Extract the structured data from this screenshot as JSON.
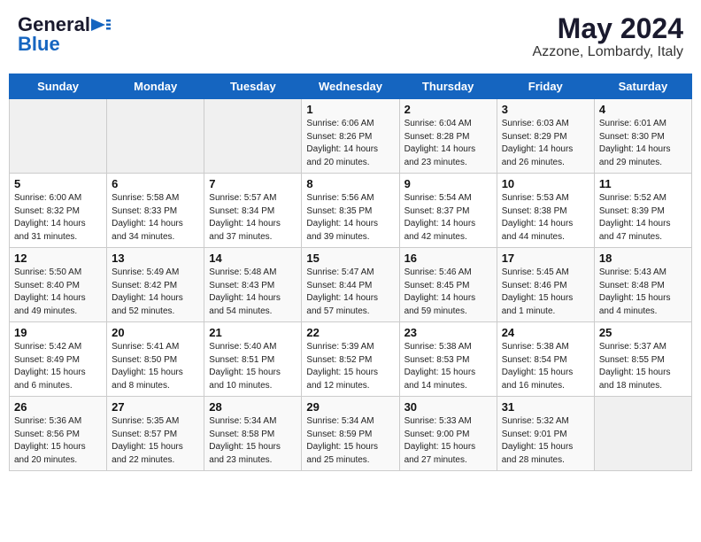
{
  "header": {
    "logo_general": "General",
    "logo_blue": "Blue",
    "month": "May 2024",
    "location": "Azzone, Lombardy, Italy"
  },
  "days_of_week": [
    "Sunday",
    "Monday",
    "Tuesday",
    "Wednesday",
    "Thursday",
    "Friday",
    "Saturday"
  ],
  "weeks": [
    [
      {
        "day": "",
        "info": ""
      },
      {
        "day": "",
        "info": ""
      },
      {
        "day": "",
        "info": ""
      },
      {
        "day": "1",
        "info": "Sunrise: 6:06 AM\nSunset: 8:26 PM\nDaylight: 14 hours\nand 20 minutes."
      },
      {
        "day": "2",
        "info": "Sunrise: 6:04 AM\nSunset: 8:28 PM\nDaylight: 14 hours\nand 23 minutes."
      },
      {
        "day": "3",
        "info": "Sunrise: 6:03 AM\nSunset: 8:29 PM\nDaylight: 14 hours\nand 26 minutes."
      },
      {
        "day": "4",
        "info": "Sunrise: 6:01 AM\nSunset: 8:30 PM\nDaylight: 14 hours\nand 29 minutes."
      }
    ],
    [
      {
        "day": "5",
        "info": "Sunrise: 6:00 AM\nSunset: 8:32 PM\nDaylight: 14 hours\nand 31 minutes."
      },
      {
        "day": "6",
        "info": "Sunrise: 5:58 AM\nSunset: 8:33 PM\nDaylight: 14 hours\nand 34 minutes."
      },
      {
        "day": "7",
        "info": "Sunrise: 5:57 AM\nSunset: 8:34 PM\nDaylight: 14 hours\nand 37 minutes."
      },
      {
        "day": "8",
        "info": "Sunrise: 5:56 AM\nSunset: 8:35 PM\nDaylight: 14 hours\nand 39 minutes."
      },
      {
        "day": "9",
        "info": "Sunrise: 5:54 AM\nSunset: 8:37 PM\nDaylight: 14 hours\nand 42 minutes."
      },
      {
        "day": "10",
        "info": "Sunrise: 5:53 AM\nSunset: 8:38 PM\nDaylight: 14 hours\nand 44 minutes."
      },
      {
        "day": "11",
        "info": "Sunrise: 5:52 AM\nSunset: 8:39 PM\nDaylight: 14 hours\nand 47 minutes."
      }
    ],
    [
      {
        "day": "12",
        "info": "Sunrise: 5:50 AM\nSunset: 8:40 PM\nDaylight: 14 hours\nand 49 minutes."
      },
      {
        "day": "13",
        "info": "Sunrise: 5:49 AM\nSunset: 8:42 PM\nDaylight: 14 hours\nand 52 minutes."
      },
      {
        "day": "14",
        "info": "Sunrise: 5:48 AM\nSunset: 8:43 PM\nDaylight: 14 hours\nand 54 minutes."
      },
      {
        "day": "15",
        "info": "Sunrise: 5:47 AM\nSunset: 8:44 PM\nDaylight: 14 hours\nand 57 minutes."
      },
      {
        "day": "16",
        "info": "Sunrise: 5:46 AM\nSunset: 8:45 PM\nDaylight: 14 hours\nand 59 minutes."
      },
      {
        "day": "17",
        "info": "Sunrise: 5:45 AM\nSunset: 8:46 PM\nDaylight: 15 hours\nand 1 minute."
      },
      {
        "day": "18",
        "info": "Sunrise: 5:43 AM\nSunset: 8:48 PM\nDaylight: 15 hours\nand 4 minutes."
      }
    ],
    [
      {
        "day": "19",
        "info": "Sunrise: 5:42 AM\nSunset: 8:49 PM\nDaylight: 15 hours\nand 6 minutes."
      },
      {
        "day": "20",
        "info": "Sunrise: 5:41 AM\nSunset: 8:50 PM\nDaylight: 15 hours\nand 8 minutes."
      },
      {
        "day": "21",
        "info": "Sunrise: 5:40 AM\nSunset: 8:51 PM\nDaylight: 15 hours\nand 10 minutes."
      },
      {
        "day": "22",
        "info": "Sunrise: 5:39 AM\nSunset: 8:52 PM\nDaylight: 15 hours\nand 12 minutes."
      },
      {
        "day": "23",
        "info": "Sunrise: 5:38 AM\nSunset: 8:53 PM\nDaylight: 15 hours\nand 14 minutes."
      },
      {
        "day": "24",
        "info": "Sunrise: 5:38 AM\nSunset: 8:54 PM\nDaylight: 15 hours\nand 16 minutes."
      },
      {
        "day": "25",
        "info": "Sunrise: 5:37 AM\nSunset: 8:55 PM\nDaylight: 15 hours\nand 18 minutes."
      }
    ],
    [
      {
        "day": "26",
        "info": "Sunrise: 5:36 AM\nSunset: 8:56 PM\nDaylight: 15 hours\nand 20 minutes."
      },
      {
        "day": "27",
        "info": "Sunrise: 5:35 AM\nSunset: 8:57 PM\nDaylight: 15 hours\nand 22 minutes."
      },
      {
        "day": "28",
        "info": "Sunrise: 5:34 AM\nSunset: 8:58 PM\nDaylight: 15 hours\nand 23 minutes."
      },
      {
        "day": "29",
        "info": "Sunrise: 5:34 AM\nSunset: 8:59 PM\nDaylight: 15 hours\nand 25 minutes."
      },
      {
        "day": "30",
        "info": "Sunrise: 5:33 AM\nSunset: 9:00 PM\nDaylight: 15 hours\nand 27 minutes."
      },
      {
        "day": "31",
        "info": "Sunrise: 5:32 AM\nSunset: 9:01 PM\nDaylight: 15 hours\nand 28 minutes."
      },
      {
        "day": "",
        "info": ""
      }
    ]
  ]
}
